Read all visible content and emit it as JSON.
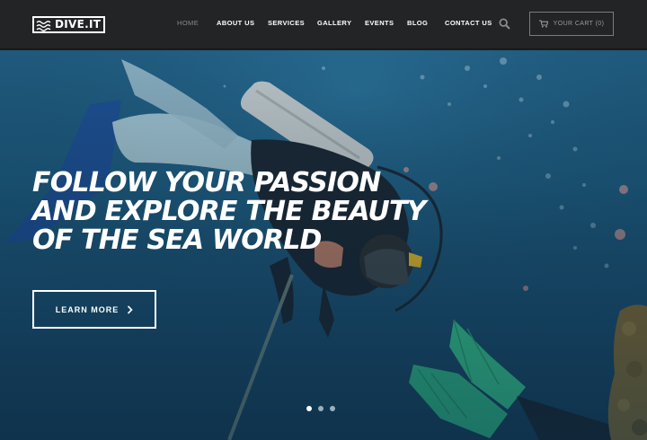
{
  "brand": {
    "name": "DIVE.IT"
  },
  "nav": {
    "items": [
      {
        "label": "HOME",
        "active": true
      },
      {
        "label": "ABOUT US",
        "active": false
      },
      {
        "label": "SERVICES",
        "active": false
      },
      {
        "label": "GALLERY",
        "active": false
      },
      {
        "label": "EVENTS",
        "active": false
      },
      {
        "label": "BLOG",
        "active": false
      },
      {
        "label": "CONTACT US",
        "active": false
      }
    ],
    "search_icon": "search-icon"
  },
  "cart": {
    "label": "YOUR CART (0)",
    "icon": "cart-icon"
  },
  "hero": {
    "headline_lines": [
      "FOLLOW YOUR PASSION",
      "AND EXPLORE THE BEAUTY",
      "OF THE SEA WORLD"
    ],
    "cta_label": "LEARN MORE",
    "slides": {
      "count": 3,
      "active": 1
    }
  },
  "colors": {
    "header_bg": "#232425",
    "sea_blue": "#1c5a7e",
    "fin_green": "#3fb58a"
  }
}
